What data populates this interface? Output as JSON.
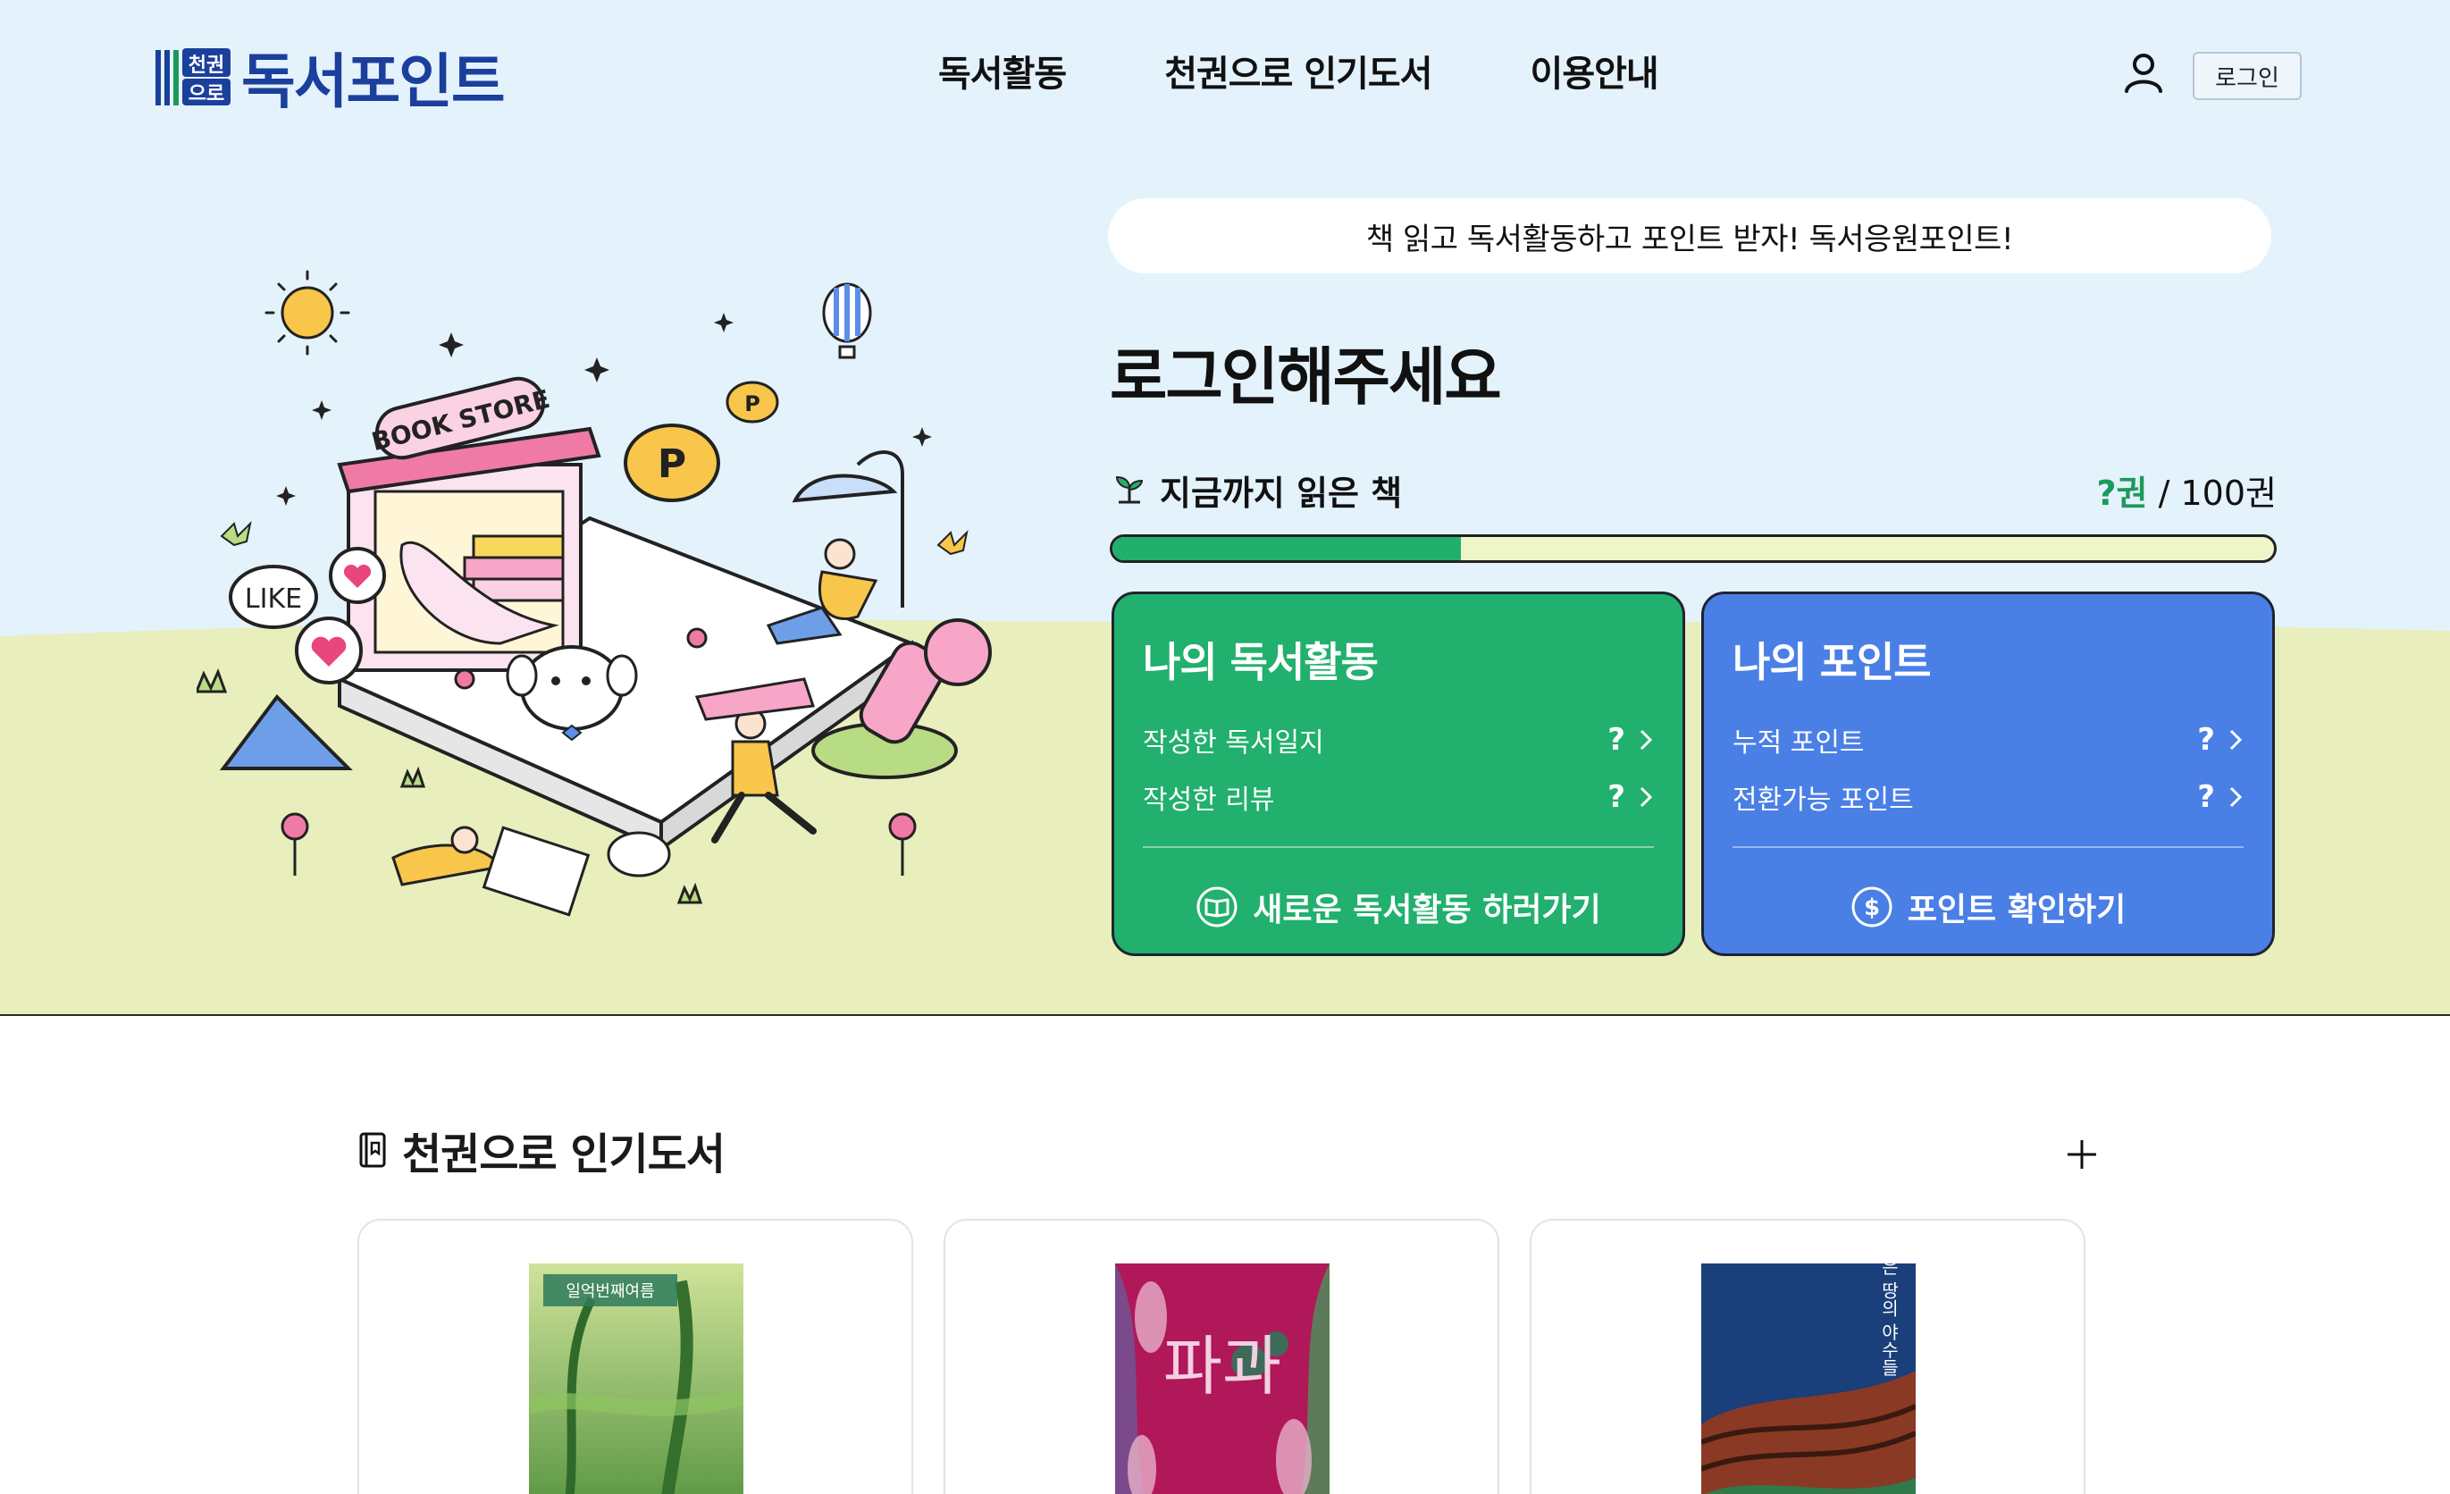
{
  "header": {
    "logo_mark_text": "천권으로",
    "logo_text": "독서포인트",
    "nav": [
      "독서활동",
      "천권으로 인기도서",
      "이용안내"
    ],
    "login_label": "로그인"
  },
  "hero": {
    "illustration_text": {
      "store_sign": "BOOK STORE",
      "like_bubble": "LIKE"
    },
    "slogan": "책 읽고 독서활동하고 포인트 받자! 독서응원포인트!",
    "greeting": "로그인해주세요",
    "read_label": "지금까지 읽은 책",
    "read_current": "?권",
    "read_total": "/ 100권",
    "progress_fraction": 0.3,
    "activity_card": {
      "title": "나의 독서활동",
      "rows": [
        {
          "label": "작성한 독서일지",
          "value": "?"
        },
        {
          "label": "작성한 리뷰",
          "value": "?"
        }
      ],
      "action": "새로운 독서활동 하러가기"
    },
    "point_card": {
      "title": "나의 포인트",
      "rows": [
        {
          "label": "누적 포인트",
          "value": "?"
        },
        {
          "label": "전환가능 포인트",
          "value": "?"
        }
      ],
      "action": "포인트 확인하기"
    }
  },
  "popular": {
    "title": "천권으로 인기도서",
    "books": [
      {
        "cover_text": "일억번째여름"
      },
      {
        "cover_text": "파과"
      },
      {
        "cover_text": "작은 땅의 야수들"
      }
    ]
  },
  "colors": {
    "sky": "#e4f2fc",
    "ground": "#e8eebc",
    "brand_navy": "#1b3f9c",
    "green_card": "#21b06d",
    "blue_card": "#4a7fe6"
  }
}
